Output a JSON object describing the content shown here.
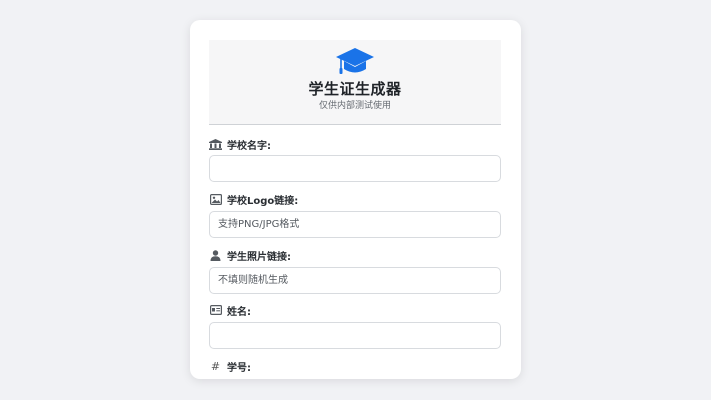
{
  "header": {
    "icon": "graduation-cap-icon",
    "title": "学生证生成器",
    "subtitle": "仅供内部测试使用",
    "accent_color": "#1a73e8"
  },
  "form": {
    "fields": [
      {
        "icon": "university-icon",
        "label": "学校名字:",
        "value": "",
        "placeholder": ""
      },
      {
        "icon": "image-icon",
        "label": "学校Logo链接:",
        "value": "",
        "placeholder": "支持PNG/JPG格式"
      },
      {
        "icon": "user-icon",
        "label": "学生照片链接:",
        "value": "",
        "placeholder": "不填则随机生成"
      },
      {
        "icon": "id-card-icon",
        "label": "姓名:",
        "value": "",
        "placeholder": ""
      },
      {
        "icon": "hashtag-icon",
        "label": "学号:",
        "value": "",
        "placeholder": ""
      }
    ]
  }
}
